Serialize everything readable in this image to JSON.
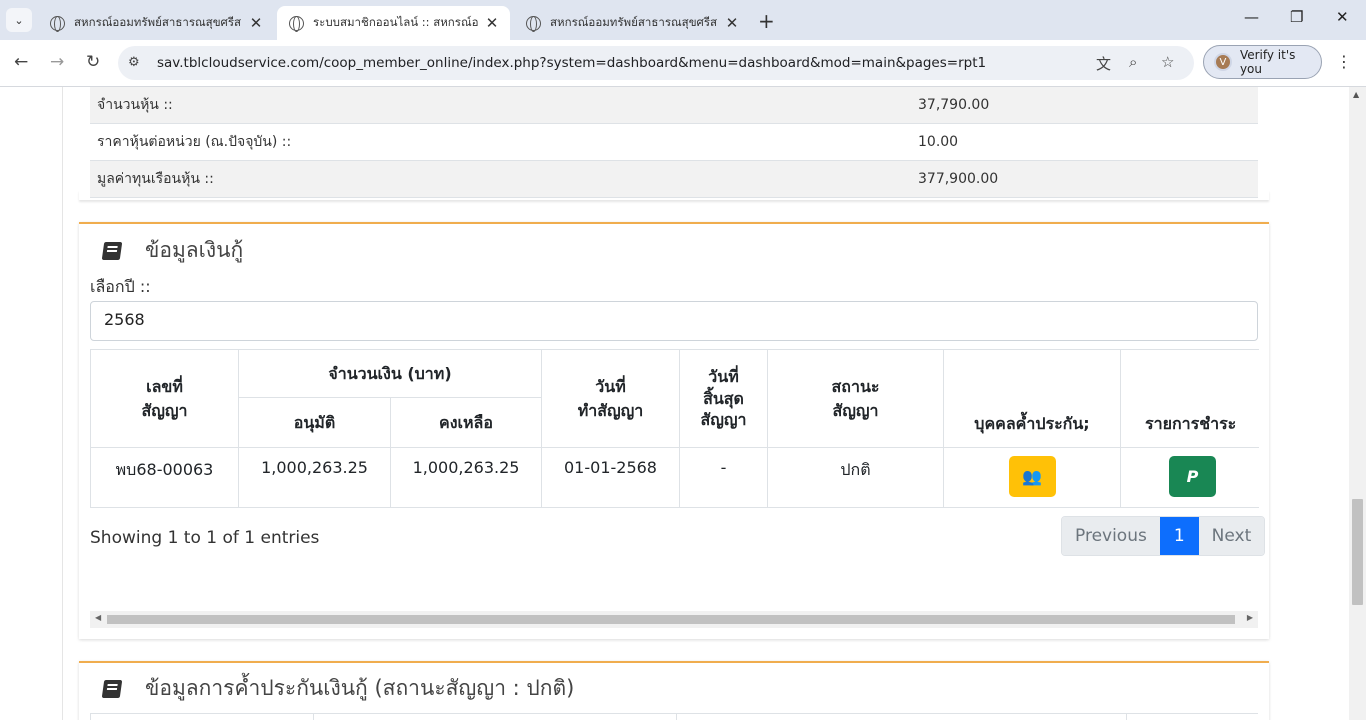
{
  "browser": {
    "tabs": [
      {
        "title": "สหกรณ์ออมทรัพย์สาธารณสุขศรีสะเกษ",
        "active": false
      },
      {
        "title": "ระบบสมาชิกออนไลน์ :: สหกรณ์ออมทรัพย์",
        "active": true
      },
      {
        "title": "สหกรณ์ออมทรัพย์สาธารณสุขศรีสะเกษ",
        "active": false
      }
    ],
    "url": "sav.tblcloudservice.com/coop_member_online/index.php?system=dashboard&menu=dashboard&mod=main&pages=rpt1",
    "verify_label": "Verify it's you",
    "avatar_letter": "V"
  },
  "shares": {
    "rows": [
      {
        "label": "จำนวนหุ้น ::",
        "value": "37,790.00"
      },
      {
        "label": "ราคาหุ้นต่อหน่วย (ณ.ปัจจุบัน) ::",
        "value": "10.00"
      },
      {
        "label": "มูลค่าทุนเรือนหุ้น ::",
        "value": "377,900.00"
      }
    ]
  },
  "loan": {
    "title": "ข้อมูลเงินกู้",
    "year_label": "เลือกปี ::",
    "year_value": "2568",
    "headers": {
      "contract_no": [
        "เลขที่",
        "สัญญา"
      ],
      "amount": "จำนวนเงิน (บาท)",
      "approved": "อนุมัติ",
      "balance": "คงเหลือ",
      "date": [
        "วันที่",
        "ทำสัญญา"
      ],
      "end_date": [
        "วันที่",
        "สิ้นสุด",
        "สัญญา"
      ],
      "status": [
        "สถานะ",
        "สัญญา"
      ],
      "guarantor": "บุคคลค้ำประกัน;",
      "payments": "รายการชำระ"
    },
    "rows": [
      {
        "contract_no": "พบ68-00063",
        "approved": "1,000,263.25",
        "balance": "1,000,263.25",
        "date": "01-01-2568",
        "end_date": "-",
        "status": "ปกติ",
        "pay_glyph": "P"
      }
    ],
    "showing": "Showing 1 to 1 of 1 entries",
    "pager": {
      "previous": "Previous",
      "current": "1",
      "next": "Next"
    }
  },
  "guarantee": {
    "title": "ข้อมูลการค้ำประกันเงินกู้ (สถานะสัญญา : ปกติ)"
  },
  "icons": [
    "globe-icon",
    "close-icon",
    "plus-icon",
    "back-icon",
    "forward-icon",
    "reload-icon",
    "site-info-icon",
    "translate-icon",
    "zoom-icon",
    "star-icon",
    "book-icon",
    "users-icon",
    "paypal-icon",
    "menu-icon"
  ],
  "colors": {
    "accent_border": "#f0ad4e",
    "pager_active": "#0d6efd",
    "guarantor_btn": "#ffc107",
    "pay_btn": "#198754"
  }
}
